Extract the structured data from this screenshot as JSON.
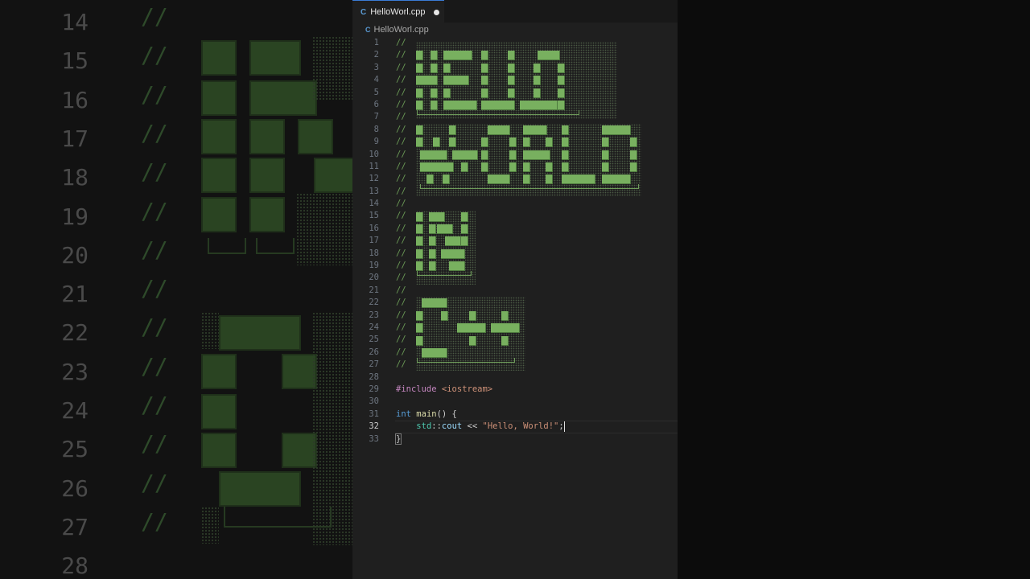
{
  "tab": {
    "filename": "HelloWorl.cpp",
    "dirty": true,
    "icon": "cpp-file-icon"
  },
  "breadcrumb": {
    "filename": "HelloWorl.cpp"
  },
  "code": {
    "comment": "//",
    "include_directive": "#include",
    "include_target": "<iostream>",
    "main_type": "int",
    "main_name": "main",
    "main_rest": "() {",
    "ns": "std",
    "sep": "::",
    "cout": "cout",
    "op": " << ",
    "string": "\"Hello, World!\"",
    "semi": ";",
    "close": "}",
    "active_line": 32
  },
  "line_numbers": [
    "1",
    "2",
    "3",
    "4",
    "5",
    "6",
    "7",
    "8",
    "9",
    "10",
    "11",
    "12",
    "13",
    "14",
    "15",
    "16",
    "17",
    "18",
    "19",
    "20",
    "21",
    "22",
    "23",
    "24",
    "25",
    "26",
    "27",
    "28",
    "29",
    "30",
    "31",
    "32",
    "33"
  ],
  "background_line_numbers": [
    "14",
    "15",
    "16",
    "17",
    "18",
    "19",
    "20",
    "21",
    "22",
    "23",
    "24",
    "25",
    "26",
    "27",
    "28"
  ],
  "colors": {
    "comment": "#6a9955",
    "keyword": "#569cd6",
    "string": "#ce9178",
    "art": "#78b05f",
    "editor_bg": "#1f1f1f"
  }
}
